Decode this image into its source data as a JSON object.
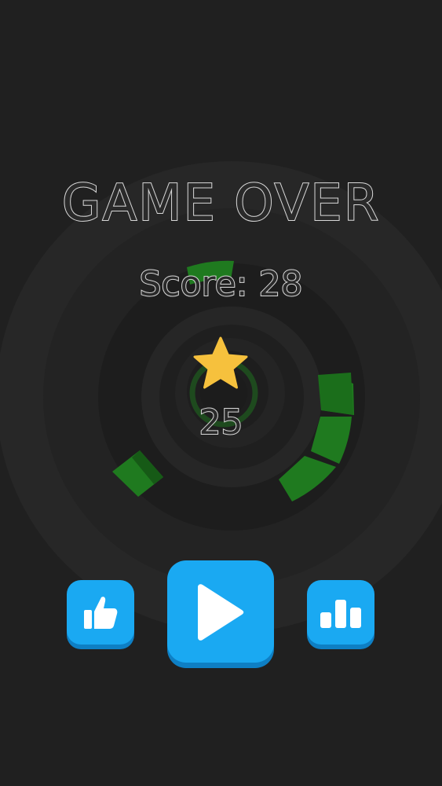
{
  "title": "GAME OVER",
  "score_label": "Score: 28",
  "best_score": "25",
  "colors": {
    "background": "#202020",
    "ring_light": "#2a2a2a",
    "ring_dark": "#1a1a1a",
    "segment_green": "#1f7a1f",
    "segment_green_dark": "#165a16",
    "button_blue": "#1aa9f2",
    "button_shadow": "#0e7fc4",
    "star": "#f6c13d"
  },
  "buttons": {
    "like": {
      "icon": "thumbs-up-icon"
    },
    "play": {
      "icon": "play-icon"
    },
    "leaderboard": {
      "icon": "leaderboard-icon"
    }
  }
}
